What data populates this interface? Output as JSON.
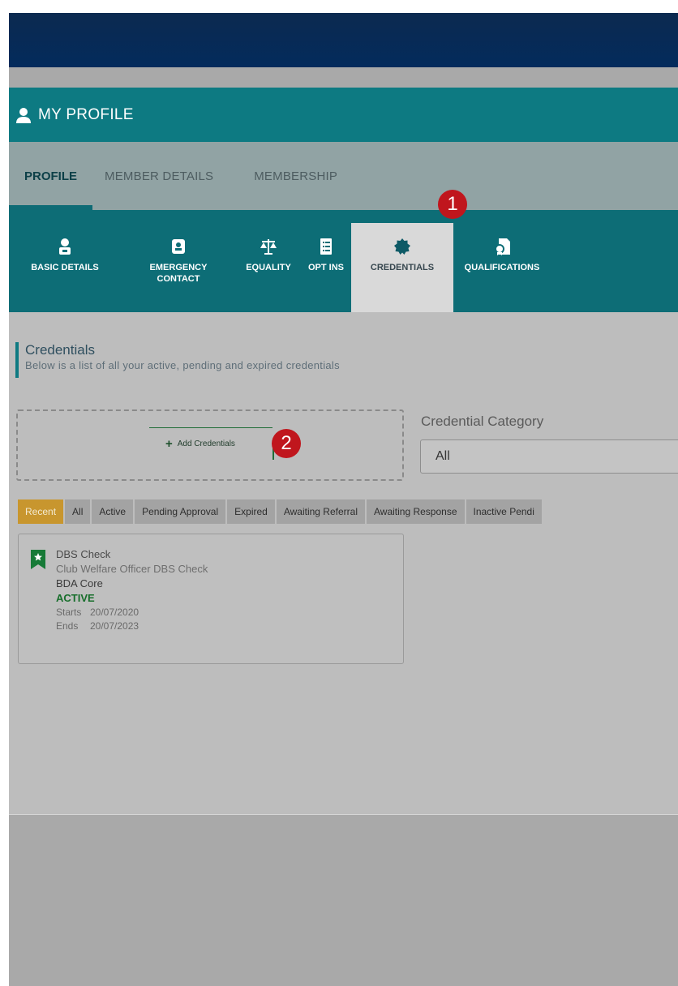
{
  "header": {
    "title": "MY PROFILE"
  },
  "subnav": {
    "tabs": [
      {
        "label": "PROFILE",
        "active": true
      },
      {
        "label": "MEMBER DETAILS",
        "active": false
      },
      {
        "label": "MEMBERSHIP",
        "active": false
      }
    ]
  },
  "icon_tabs": [
    {
      "label": "BASIC DETAILS",
      "icon": "person-icon"
    },
    {
      "label": "EMERGENCY\nCONTACT",
      "icon": "contact-card-icon"
    },
    {
      "label": "EQUALITY",
      "icon": "scales-icon"
    },
    {
      "label": "OPT INS",
      "icon": "checklist-icon"
    },
    {
      "label": "CREDENTIALS",
      "icon": "seal-icon",
      "active": true
    },
    {
      "label": "QUALIFICATIONS",
      "icon": "certificate-icon"
    }
  ],
  "annotations": {
    "badge1": "1",
    "badge2": "2"
  },
  "section": {
    "title": "Credentials",
    "subtitle": "Below is a list of all your active, pending and expired credentials"
  },
  "add_credentials": {
    "label": "Add Credentials"
  },
  "category": {
    "label": "Credential Category",
    "selected": "All"
  },
  "filters": [
    "Recent",
    "All",
    "Active",
    "Pending Approval",
    "Expired",
    "Awaiting Referral",
    "Awaiting Response",
    "Inactive Pendi"
  ],
  "credential": {
    "name": "DBS Check",
    "description": "Club Welfare Officer DBS Check",
    "organisation": "BDA Core",
    "status": "ACTIVE",
    "starts_label": "Starts",
    "starts": "20/07/2020",
    "ends_label": "Ends",
    "ends": "20/07/2023"
  },
  "colors": {
    "header": "#0d7a82",
    "iconbar": "#0d6d76",
    "active_filter": "#c8962e",
    "status_active": "#176e2b",
    "badge": "#c0161d"
  }
}
